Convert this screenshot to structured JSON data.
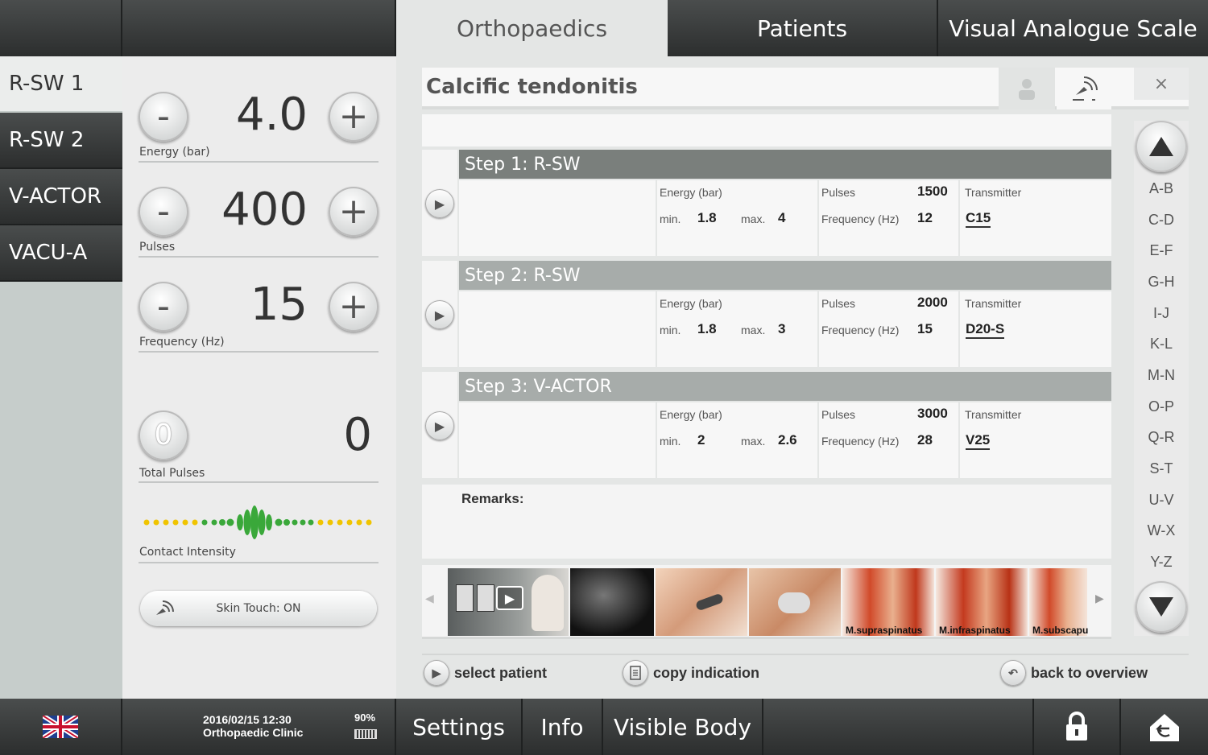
{
  "top_tabs": [
    {
      "label": "Orthopaedics",
      "active": true
    },
    {
      "label": "Patients",
      "active": false
    },
    {
      "label": "Visual Analogue Scale",
      "active": false
    }
  ],
  "modes": [
    "R-SW 1",
    "R-SW 2",
    "V-ACTOR",
    "VACU-A"
  ],
  "active_mode": "R-SW 1",
  "params": {
    "energy": {
      "value": "4.0",
      "label": "Energy (bar)"
    },
    "pulses": {
      "value": "400",
      "label": "Pulses"
    },
    "frequency": {
      "value": "15",
      "label": "Frequency (Hz)"
    },
    "total_pulses": {
      "value": "0",
      "label": "Total Pulses",
      "icon_text": "0"
    },
    "contact_intensity": {
      "label": "Contact Intensity"
    },
    "skin_touch": "Skin Touch: ON",
    "minus": "-",
    "plus": "+"
  },
  "indication": {
    "title": "Calcific tendonitis",
    "close": "×"
  },
  "step_labels": {
    "energy": "Energy (bar)",
    "min": "min.",
    "max": "max.",
    "pulses": "Pulses",
    "frequency": "Frequency (Hz)",
    "transmitter": "Transmitter"
  },
  "steps": [
    {
      "title": "Step 1:  R-SW",
      "min": "1.8",
      "max": "4",
      "pulses": "1500",
      "frequency": "12",
      "transmitter": "C15"
    },
    {
      "title": "Step 2:  R-SW",
      "min": "1.8",
      "max": "3",
      "pulses": "2000",
      "frequency": "15",
      "transmitter": "D20-S"
    },
    {
      "title": "Step 3:  V-ACTOR",
      "min": "2",
      "max": "2.6",
      "pulses": "3000",
      "frequency": "28",
      "transmitter": "V25"
    }
  ],
  "remarks_label": "Remarks:",
  "gallery_captions": [
    "M.supraspinatus",
    "M.infraspinatus",
    "M.subscapu"
  ],
  "alphabet": [
    "A-B",
    "C-D",
    "E-F",
    "G-H",
    "I-J",
    "K-L",
    "M-N",
    "O-P",
    "Q-R",
    "S-T",
    "U-V",
    "W-X",
    "Y-Z"
  ],
  "actions": {
    "select_patient": "select patient",
    "copy_indication": "copy indication",
    "back_to_overview": "back to overview"
  },
  "status": {
    "date_time": "2016/02/15   12:30",
    "clinic": "Orthopaedic Clinic",
    "battery": "90%"
  },
  "bottom_tabs": [
    "Settings",
    "Info",
    "Visible Body"
  ],
  "colors": {
    "step_active_header": "#7a7f7c",
    "step_header": "#a7acaa",
    "contact_green": "#3aa83a",
    "contact_yellow": "#f0c400"
  }
}
